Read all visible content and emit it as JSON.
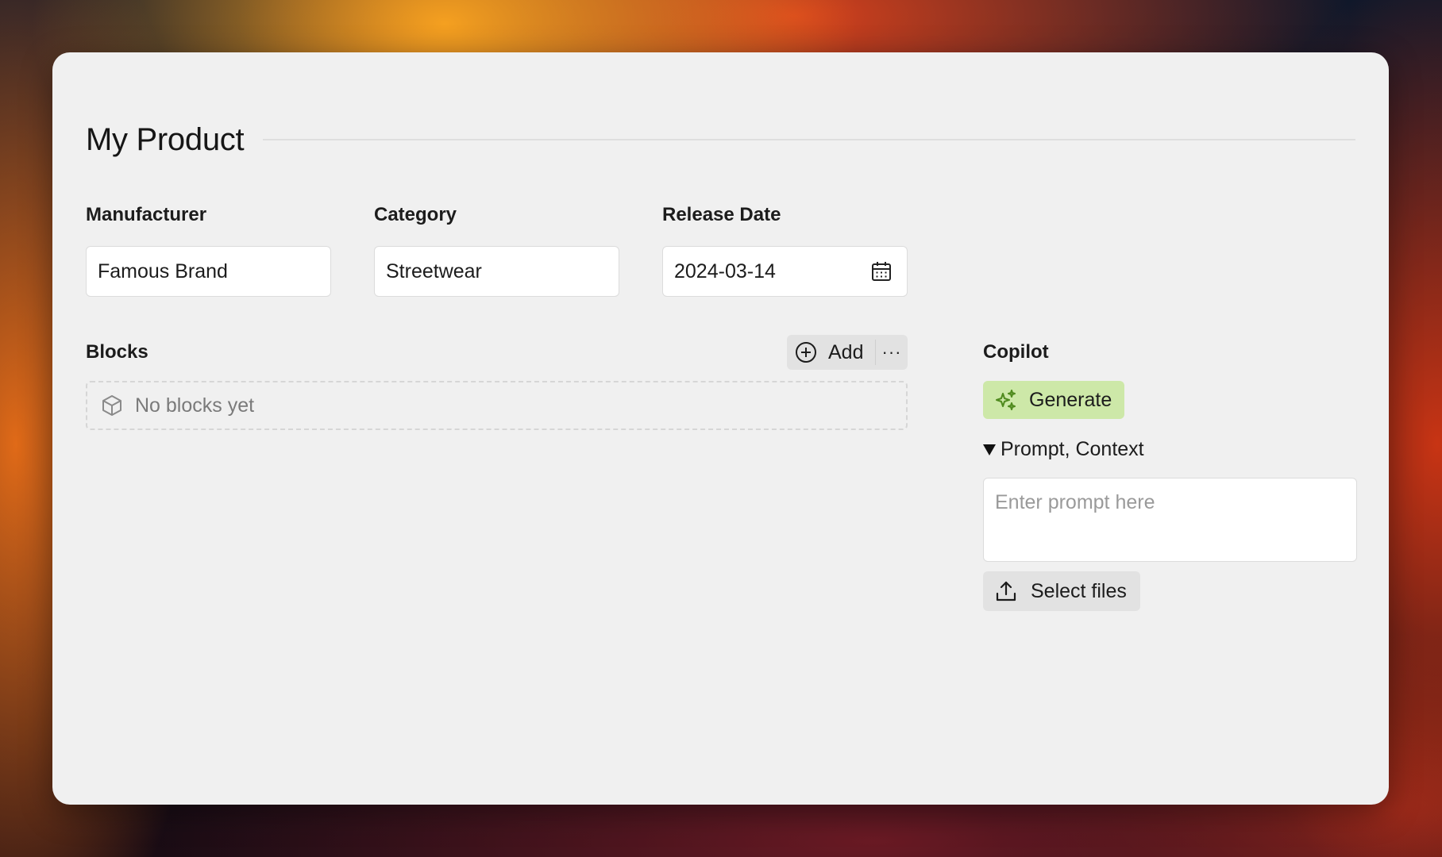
{
  "page": {
    "title": "My Product"
  },
  "fields": {
    "manufacturer": {
      "label": "Manufacturer",
      "value": "Famous Brand"
    },
    "category": {
      "label": "Category",
      "value": "Streetwear"
    },
    "release_date": {
      "label": "Release Date",
      "value": "2024-03-14",
      "icon": "calendar-icon"
    }
  },
  "blocks": {
    "label": "Blocks",
    "add_label": "Add",
    "add_icon": "plus-circle-icon",
    "more_icon": "more-horizontal-icon",
    "more_glyph": "···",
    "empty_text": "No blocks yet",
    "empty_icon": "cube-icon"
  },
  "copilot": {
    "label": "Copilot",
    "generate_label": "Generate",
    "generate_icon": "sparkles-icon",
    "generate_color": "#cde8a8",
    "details_summary": "Prompt, Context",
    "prompt_placeholder": "Enter prompt here",
    "prompt_value": "",
    "select_files_label": "Select files",
    "select_files_icon": "upload-icon"
  }
}
